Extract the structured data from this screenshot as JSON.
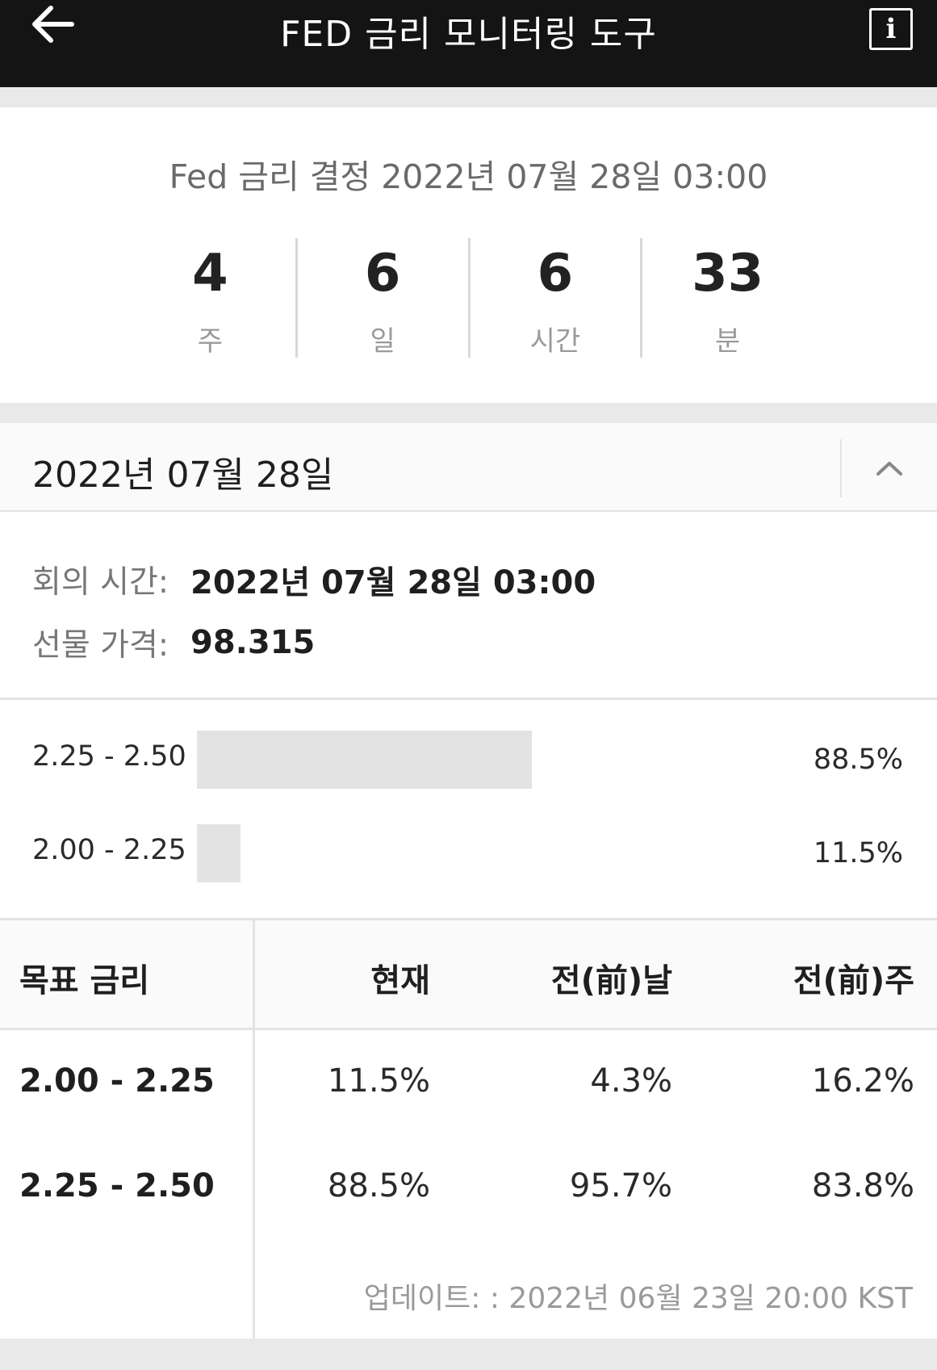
{
  "header": {
    "title": "FED 금리 모니터링 도구",
    "back_icon": "arrow-left-icon",
    "info_icon": "info-icon"
  },
  "countdown": {
    "decision_text": "Fed 금리 결정 2022년 07월 28일 03:00",
    "units": [
      {
        "value": "4",
        "label": "주"
      },
      {
        "value": "6",
        "label": "일"
      },
      {
        "value": "6",
        "label": "시간"
      },
      {
        "value": "33",
        "label": "분"
      }
    ]
  },
  "meeting": {
    "date": "2022년 07월 28일",
    "collapse_icon": "chevron-up-icon",
    "time_label": "회의 시간:",
    "time_value": "2022년 07월 28일 03:00",
    "futures_label": "선물 가격:",
    "futures_value": "98.315",
    "probabilities": [
      {
        "range": "2.25 - 2.50",
        "pct_text": "88.5%",
        "value": 88.5
      },
      {
        "range": "2.00 - 2.25",
        "pct_text": "11.5%",
        "value": 11.5
      }
    ]
  },
  "table": {
    "headers": [
      "목표 금리",
      "현재",
      "전(前)날",
      "전(前)주"
    ],
    "rows": [
      [
        "2.00 - 2.25",
        "11.5%",
        "4.3%",
        "16.2%"
      ],
      [
        "2.25 - 2.50",
        "88.5%",
        "95.7%",
        "83.8%"
      ]
    ],
    "updated": "업데이트: : 2022년 06월 23일 20:00 KST"
  },
  "colors": {
    "topbar": "#141414",
    "bar": "#e3e3e3",
    "background": "#e9e9e9"
  }
}
